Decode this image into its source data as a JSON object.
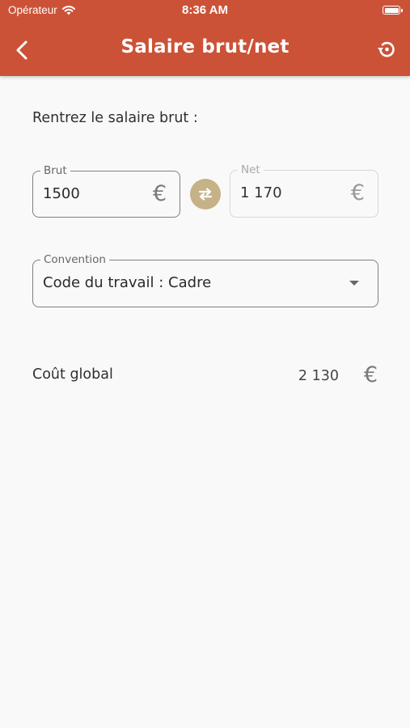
{
  "status_bar": {
    "carrier": "Opérateur",
    "time": "8:36 AM"
  },
  "header": {
    "title": "Salaire brut/net",
    "back_icon": "chevron-left-icon",
    "reset_icon": "history-reset-icon"
  },
  "form": {
    "prompt": "Rentrez le salaire brut :",
    "brut": {
      "label": "Brut",
      "value": "1500",
      "currency": "€"
    },
    "swap_icon": "swap-arrows-icon",
    "net": {
      "label": "Net",
      "value": "1 170",
      "currency": "€"
    },
    "convention": {
      "label": "Convention",
      "selected": "Code du travail : Cadre"
    }
  },
  "result": {
    "label": "Coût global",
    "value": "2 130",
    "currency": "€"
  },
  "colors": {
    "header": "#cc5237",
    "swap_button": "#c6b287",
    "background": "#f9f9f9"
  }
}
